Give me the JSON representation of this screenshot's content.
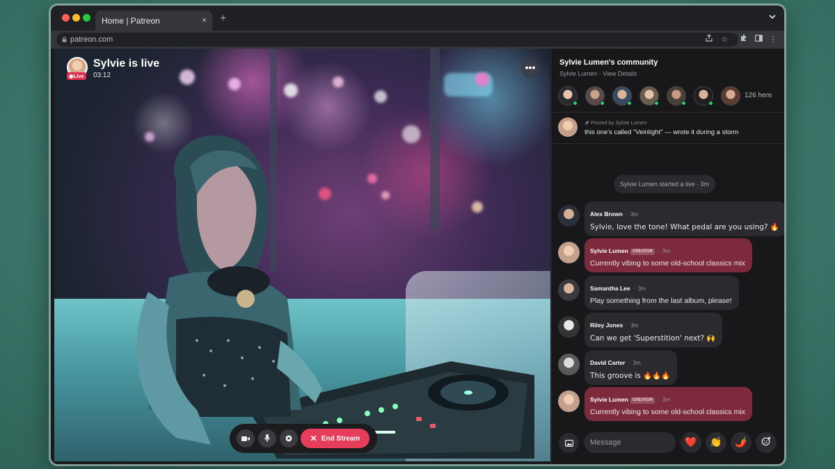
{
  "browser": {
    "tab_title": "Home | Patreon",
    "tab_close": "×",
    "new_tab": "+",
    "url": "patreon.com"
  },
  "stream": {
    "title": "Sylvie is live",
    "elapsed": "03:12",
    "live_badge": "Live",
    "more_label": "•••",
    "end_stream_label": "End Stream"
  },
  "community": {
    "name": "Sylvie Lumen's community",
    "subtitle": "Sylvie Lumen · View Details",
    "viewer_count": "126 here"
  },
  "pinned": {
    "label": "Pinned by Sylvie Lumen",
    "text": "this one's called \"Veinlight\" — wrote it during a storm"
  },
  "system_message": "Sylvie Lumen started a live · 3m",
  "messages": [
    {
      "name": "Alex Brown",
      "time": "3m",
      "text": "Sylvie, love the tone! What pedal are you using? 🔥",
      "creator": false
    },
    {
      "name": "Sylvie Lumen",
      "badge": "CREATOR",
      "time": "3m",
      "text": "Currently vibing to some old-school classics mix",
      "creator": true
    },
    {
      "name": "Samantha Lee",
      "time": "3m",
      "text": "Play something from the last album, please!",
      "creator": false
    },
    {
      "name": "Riley Jones",
      "time": "3m",
      "text": "Can we get 'Superstition' next? 🙌",
      "creator": false
    },
    {
      "name": "David Carter",
      "time": "3m",
      "text": "This groove is 🔥🔥🔥",
      "creator": false
    },
    {
      "name": "Sylvie Lumen",
      "badge": "CREATOR",
      "time": "3m",
      "text": "Currently vibing to some old-school classics mix",
      "creator": true
    }
  ],
  "composer": {
    "placeholder": "Message",
    "reactions": [
      "❤️",
      "👏",
      "🌶️"
    ]
  },
  "colors": {
    "accent": "#e63d5a",
    "creator_bubble": "#7c2a3c",
    "online": "#2ecc71"
  }
}
